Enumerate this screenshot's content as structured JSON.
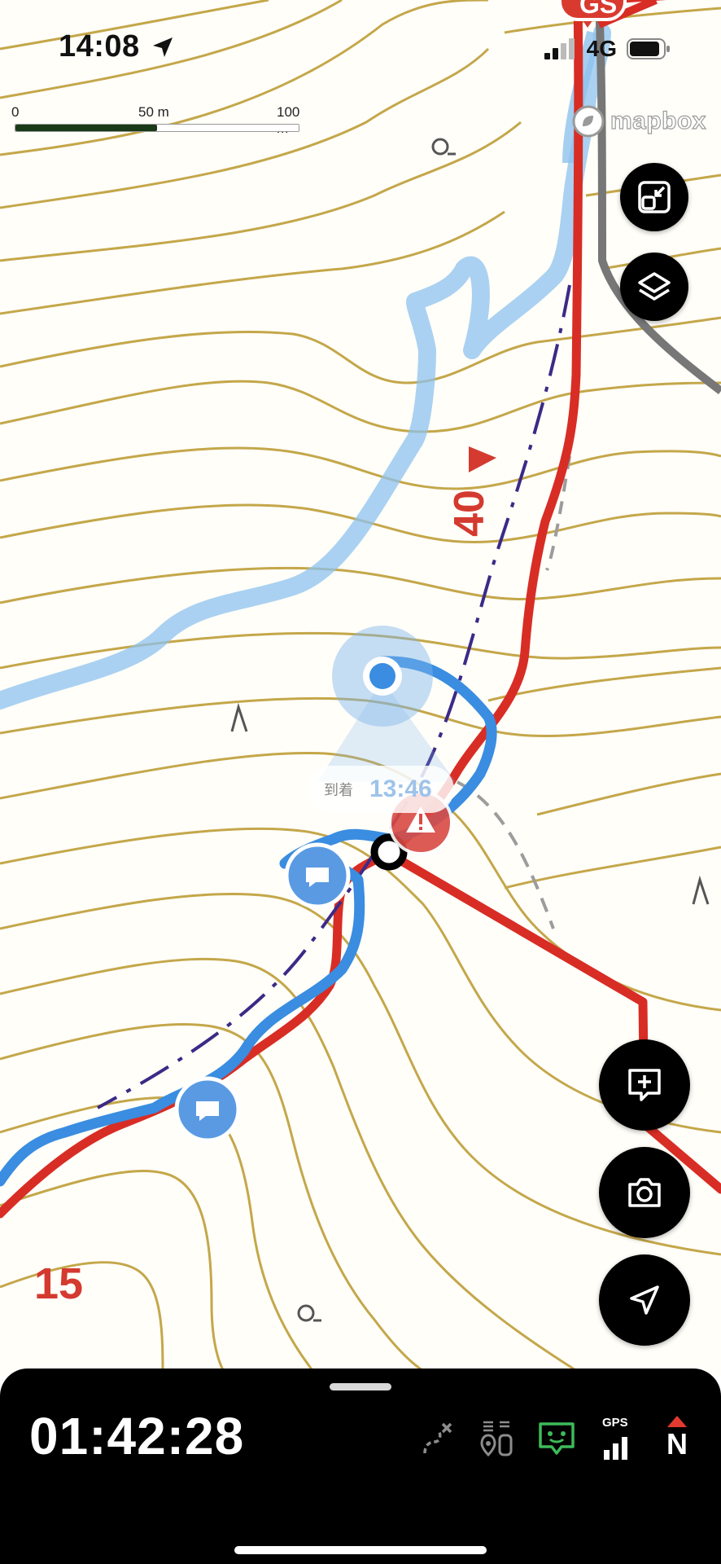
{
  "status_bar": {
    "time": "14:08",
    "location_icon": "location-arrow-icon",
    "network": "4G",
    "signal_icon": "cellular-signal-icon",
    "battery_icon": "battery-icon"
  },
  "scale": {
    "labels": [
      "0",
      "50 m",
      "100 m"
    ]
  },
  "attribution": {
    "text": "mapbox",
    "icon": "mapbox-logo-icon"
  },
  "start_marker": {
    "text": "GS",
    "color": "#d93a30"
  },
  "map_controls": {
    "fit_icon": "fit-bounds-icon",
    "layers_icon": "layers-icon",
    "add_note_icon": "add-note-icon",
    "camera_icon": "camera-icon",
    "locate_icon": "navigation-arrow-icon"
  },
  "contour_labels": [
    {
      "text": "40"
    },
    {
      "text": "15"
    }
  ],
  "eta": {
    "label": "到着",
    "time": "13:46"
  },
  "colors": {
    "route_red": "#d82d25",
    "track_blue": "#3a8de0",
    "track_light_blue": "#8ec2ee",
    "contour": "#c4a74a",
    "dash_purple": "#3b2a86"
  },
  "bottom_panel": {
    "elapsed_time": "01:42:28",
    "icons": [
      "route-off-icon",
      "members-icon",
      "chat-status-icon",
      "gps-signal-icon",
      "north-compass-icon"
    ],
    "gps_label": "GPS",
    "compass_label": "N",
    "chat_status_color": "#3dbb5a"
  }
}
